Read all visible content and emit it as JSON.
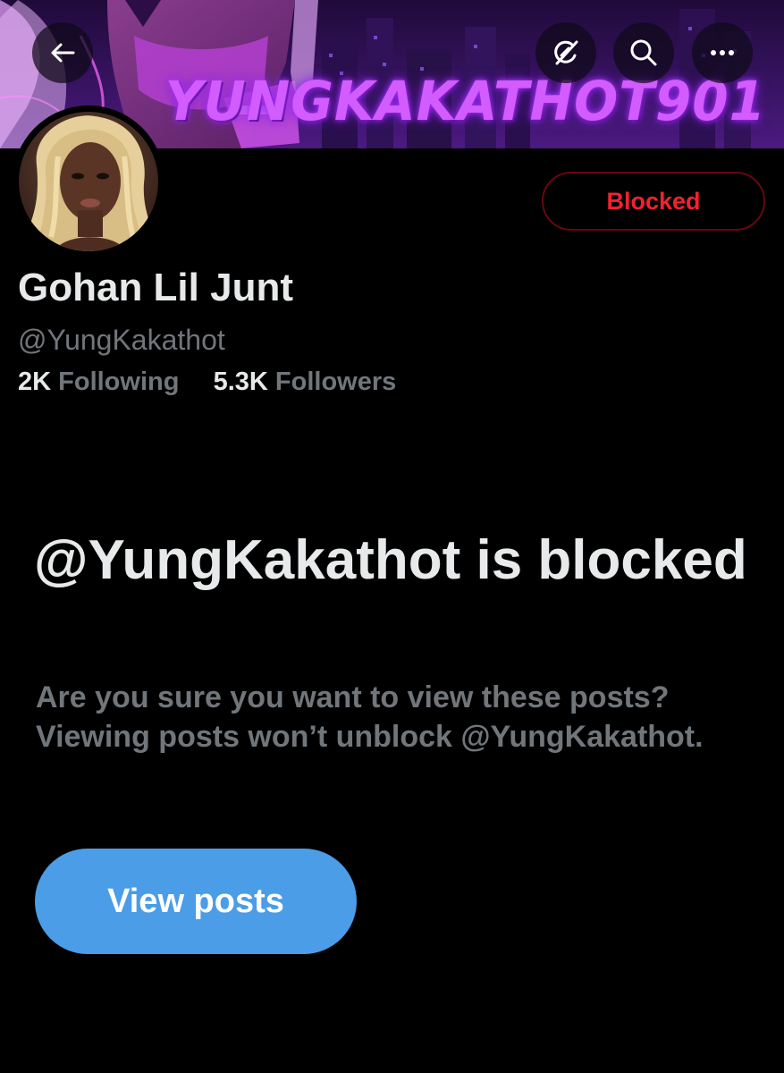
{
  "header": {
    "banner_text": "YUNGKAKATHOT901",
    "icons": {
      "back": "arrow-left-icon",
      "grok": "grok-icon",
      "search": "search-icon",
      "more": "more-horizontal-icon"
    }
  },
  "profile": {
    "display_name": "Gohan Lil Junt",
    "handle": "@YungKakathot",
    "following_count": "2K",
    "following_label": "Following",
    "followers_count": "5.3K",
    "followers_label": "Followers",
    "blocked_button_label": "Blocked"
  },
  "blocked_notice": {
    "title": "@YungKakathot is blocked",
    "body": "Are you sure you want to view these posts? Viewing posts won’t unblock @YungKakathot.",
    "view_button_label": "View posts"
  },
  "colors": {
    "background": "#000000",
    "primary_text": "#e7e9ea",
    "secondary_text": "#71767b",
    "blocked_red": "#f4212e",
    "accent_blue": "#4a9de6",
    "banner_neon": "#d35cff"
  }
}
